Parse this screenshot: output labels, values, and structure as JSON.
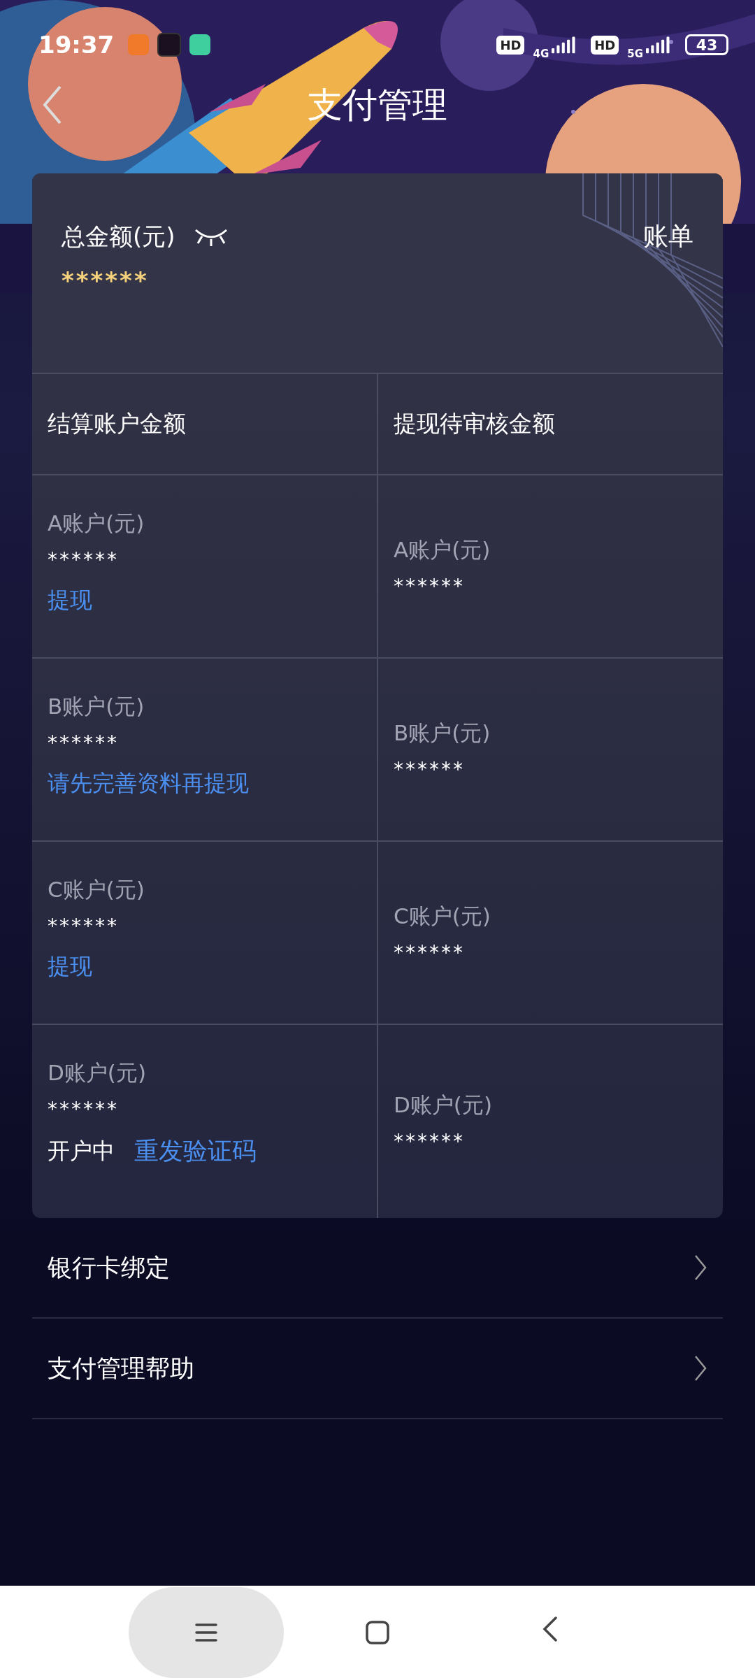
{
  "status_bar": {
    "time": "19:37",
    "sims": [
      {
        "badge": "HD",
        "network": "4G"
      },
      {
        "badge": "HD",
        "network": "5G"
      }
    ],
    "battery": "43"
  },
  "header": {
    "title": "支付管理"
  },
  "summary": {
    "label": "总金额(元)",
    "amount": "******",
    "bill_link": "账单"
  },
  "table": {
    "columns": [
      "结算账户金额",
      "提现待审核金额"
    ],
    "rows": [
      {
        "settlement": {
          "label": "A账户(元)",
          "amount": "******",
          "actions": [
            {
              "kind": "link",
              "text": "提现"
            }
          ]
        },
        "pending": {
          "label": "A账户(元)",
          "amount": "******"
        }
      },
      {
        "settlement": {
          "label": "B账户(元)",
          "amount": "******",
          "actions": [
            {
              "kind": "link",
              "text": "请先完善资料再提现"
            }
          ]
        },
        "pending": {
          "label": "B账户(元)",
          "amount": "******"
        }
      },
      {
        "settlement": {
          "label": "C账户(元)",
          "amount": "******",
          "actions": [
            {
              "kind": "link",
              "text": "提现"
            }
          ]
        },
        "pending": {
          "label": "C账户(元)",
          "amount": "******"
        }
      },
      {
        "settlement": {
          "label": "D账户(元)",
          "amount": "******",
          "actions": [
            {
              "kind": "status",
              "text": "开户中"
            },
            {
              "kind": "link",
              "text": "重发验证码"
            }
          ]
        },
        "pending": {
          "label": "D账户(元)",
          "amount": "******"
        }
      }
    ]
  },
  "menu": [
    {
      "label": "银行卡绑定"
    },
    {
      "label": "支付管理帮助"
    }
  ]
}
